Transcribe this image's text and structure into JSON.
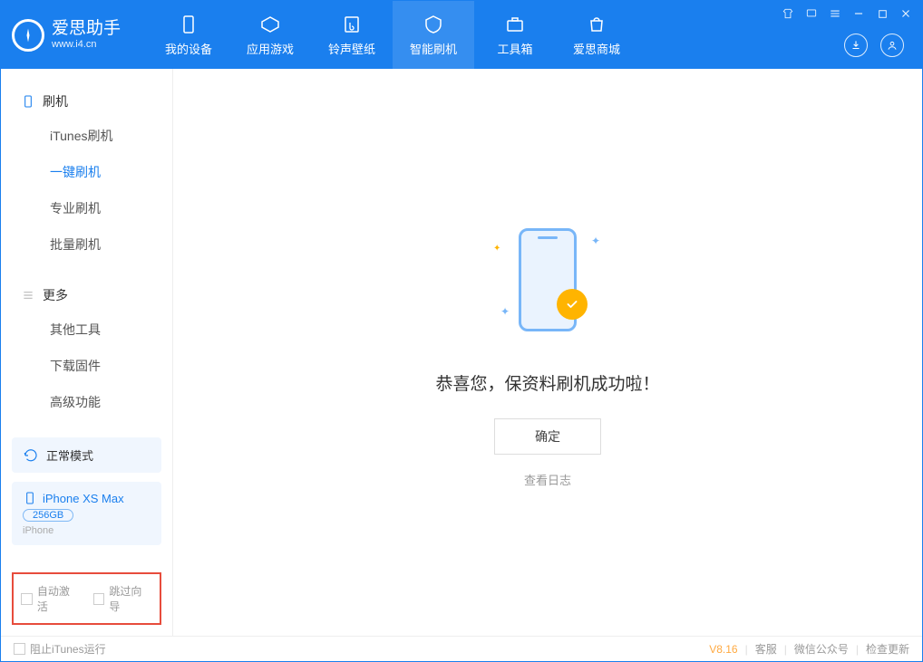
{
  "brand": {
    "name": "爱思助手",
    "url": "www.i4.cn"
  },
  "nav": {
    "tabs": [
      "我的设备",
      "应用游戏",
      "铃声壁纸",
      "智能刷机",
      "工具箱",
      "爱思商城"
    ],
    "active_index": 3
  },
  "sidebar": {
    "group_flash": {
      "title": "刷机",
      "items": [
        "iTunes刷机",
        "一键刷机",
        "专业刷机",
        "批量刷机"
      ],
      "active_index": 1
    },
    "group_more": {
      "title": "更多",
      "items": [
        "其他工具",
        "下载固件",
        "高级功能"
      ]
    },
    "mode": {
      "label": "正常模式"
    },
    "device": {
      "name": "iPhone XS Max",
      "storage": "256GB",
      "type": "iPhone"
    },
    "options": {
      "auto_activate": "自动激活",
      "skip_guide": "跳过向导"
    }
  },
  "content": {
    "success_text": "恭喜您，保资料刷机成功啦！",
    "ok_button": "确定",
    "view_log": "查看日志"
  },
  "statusbar": {
    "block_itunes": "阻止iTunes运行",
    "version": "V8.16",
    "links": [
      "客服",
      "微信公众号",
      "检查更新"
    ]
  }
}
